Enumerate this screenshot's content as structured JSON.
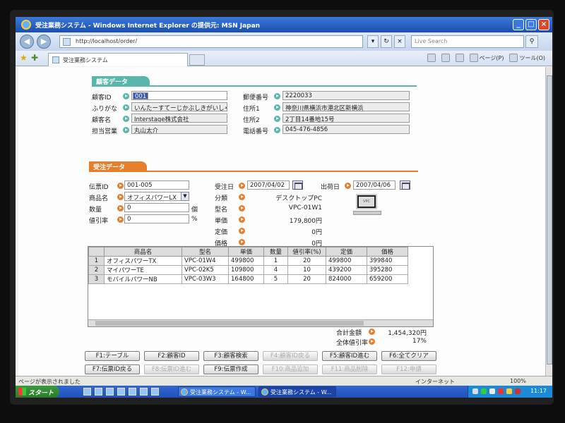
{
  "window": {
    "title": "受注業務システム - Windows Internet Explorer の提供元: MSN Japan",
    "address": "http://localhost/order/",
    "search_placeholder": "Live Search",
    "tab_title": "受注業務システム",
    "commands": [
      "ページ(P)",
      "ツール(O)"
    ]
  },
  "customer": {
    "header": "顧客データ",
    "id_label": "顧客ID",
    "id_value": "001",
    "kana_label": "ふりがな",
    "kana_value": "いんたーすてーじかぶしきがいしゃ",
    "name_label": "顧客名",
    "name_value": "Interstage株式会社",
    "rep_label": "担当営業",
    "rep_value": "丸山太介",
    "zip_label": "郵便番号",
    "zip_value": "2220033",
    "addr1_label": "住所1",
    "addr1_value": "神奈川県横浜市港北区新横浜",
    "addr2_label": "住所2",
    "addr2_value": "2丁目14番地15号",
    "tel_label": "電話番号",
    "tel_value": "045-476-4856"
  },
  "order": {
    "header": "受注データ",
    "slip_label": "伝票ID",
    "slip_value": "001-005",
    "product_label": "商品名",
    "product_value": "オフィスパワーLX",
    "qty_label": "数量",
    "qty_value": "0",
    "qty_unit": "個",
    "disc_label": "値引率",
    "disc_value": "0",
    "disc_unit": "%",
    "order_date_label": "受注日",
    "order_date_value": "2007/04/02",
    "ship_date_label": "出荷日",
    "ship_date_value": "2007/04/06",
    "category_label": "分類",
    "category_value": "デスクトップPC",
    "model_label": "型名",
    "model_value": "VPC-01W1",
    "unit_price_label": "単価",
    "unit_price_value": "179,800円",
    "list_price_label": "定価",
    "list_price_value": "0円",
    "price_label": "価格",
    "price_value": "0円",
    "product_image_caption": "VPC"
  },
  "grid": {
    "columns": [
      "商品名",
      "型名",
      "単価",
      "数量",
      "値引率(%)",
      "定価",
      "価格"
    ],
    "rows": [
      {
        "no": "1",
        "cells": [
          "オフィスパワーTX",
          "VPC-01W4",
          "499800",
          "1",
          "20",
          "499800",
          "399840"
        ]
      },
      {
        "no": "2",
        "cells": [
          "マイパワーTE",
          "VPC-02K5",
          "109800",
          "4",
          "10",
          "439200",
          "395280"
        ]
      },
      {
        "no": "3",
        "cells": [
          "モバイルパワーNB",
          "VPC-03W3",
          "164800",
          "5",
          "20",
          "824000",
          "659200"
        ]
      }
    ]
  },
  "totals": {
    "total_label": "合計金額",
    "total_value": "1,454,320円",
    "overall_disc_label": "全体値引率",
    "overall_disc_value": "17%"
  },
  "buttons": {
    "f1": "F1:テーブル",
    "f2": "F2:顧客ID",
    "f3": "F3:顧客検索",
    "f4": "F4:顧客ID戻る",
    "f5": "F5:顧客ID進む",
    "f6": "F6:全てクリア",
    "f7": "F7:伝票ID戻る",
    "f8": "F8:伝票ID進む",
    "f9": "F9:伝票作成",
    "f10": "F10:商品追加",
    "f11": "F11:商品削除",
    "f12": "F12:申請"
  },
  "status": {
    "text": "ページが表示されました",
    "zone": "インターネット",
    "zoom": "100%"
  },
  "taskbar": {
    "start": "スタート",
    "task1": "受注業務システム - W...",
    "task2": "受注業務システム - W...",
    "clock": "11:17"
  }
}
